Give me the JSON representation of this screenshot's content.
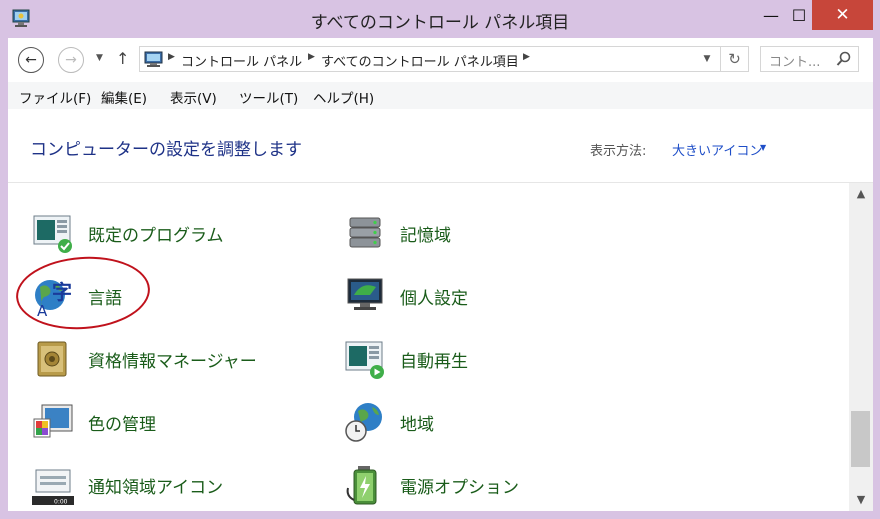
{
  "window": {
    "title": "すべてのコントロール パネル項目",
    "minimize_glyph": "—",
    "maximize_glyph": "☐",
    "close_glyph": "✕"
  },
  "nav": {
    "back_glyph": "←",
    "forward_glyph": "→",
    "history_glyph": "▼",
    "up_glyph": "↑",
    "breadcrumb": [
      "コントロール パネル",
      "すべてのコントロール パネル項目"
    ],
    "separator_glyph": "▶",
    "address_dropdown_glyph": "▼",
    "refresh_glyph": "↻",
    "search_placeholder": "コント...",
    "icons": {
      "back": "arrow-left-icon",
      "forward": "arrow-right-icon",
      "up": "arrow-up-icon",
      "refresh": "refresh-icon",
      "search": "search-icon"
    }
  },
  "menu": [
    "ファイル(F)",
    "編集(E)",
    "表示(V)",
    "ツール(T)",
    "ヘルプ(H)"
  ],
  "content": {
    "heading": "コンピューターの設定を調整します",
    "view_by_label": "表示方法:",
    "view_by_value": "大きいアイコン",
    "view_by_caret": "▼"
  },
  "items": {
    "left": [
      {
        "label": "既定のプログラム",
        "icon": "default-programs-icon"
      },
      {
        "label": "言語",
        "icon": "language-icon"
      },
      {
        "label": "資格情報マネージャー",
        "icon": "credential-manager-icon"
      },
      {
        "label": "色の管理",
        "icon": "color-management-icon"
      },
      {
        "label": "通知領域アイコン",
        "icon": "notification-area-icon"
      }
    ],
    "right": [
      {
        "label": "記憶域",
        "icon": "storage-spaces-icon"
      },
      {
        "label": "個人設定",
        "icon": "personalization-icon"
      },
      {
        "label": "自動再生",
        "icon": "autoplay-icon"
      },
      {
        "label": "地域",
        "icon": "region-icon"
      },
      {
        "label": "電源オプション",
        "icon": "power-options-icon"
      }
    ]
  },
  "notification_icon_time": "0:00",
  "scrollbar": {
    "up_glyph": "▲",
    "down_glyph": "▼"
  },
  "colors": {
    "link_green": "#1a5c1a",
    "heading_blue": "#1e3287",
    "frame": "#d8c3e3",
    "close": "#c7463a",
    "highlight_ring": "#c0121c"
  }
}
